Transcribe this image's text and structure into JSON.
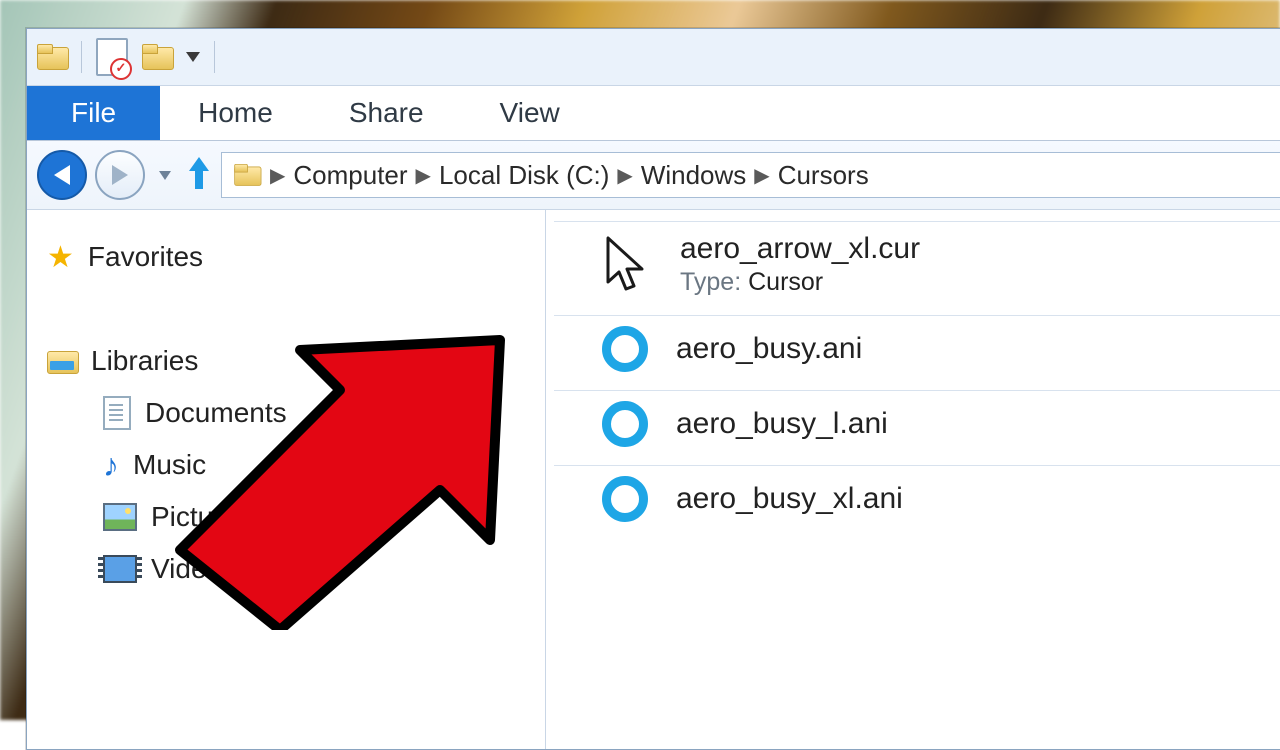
{
  "ribbon": {
    "file": "File",
    "home": "Home",
    "share": "Share",
    "view": "View"
  },
  "breadcrumb": [
    "Computer",
    "Local Disk (C:)",
    "Windows",
    "Cursors"
  ],
  "sidebar": {
    "favorites": "Favorites",
    "libraries": "Libraries",
    "items": [
      "Documents",
      "Music",
      "Pictures",
      "Videos"
    ]
  },
  "files": [
    {
      "name": "aero_arrow_xl.cur",
      "type_label": "Type:",
      "type": "Cursor",
      "icon": "cursor"
    },
    {
      "name": "aero_busy.ani",
      "icon": "ring"
    },
    {
      "name": "aero_busy_l.ani",
      "icon": "ring"
    },
    {
      "name": "aero_busy_xl.ani",
      "icon": "ring"
    }
  ]
}
